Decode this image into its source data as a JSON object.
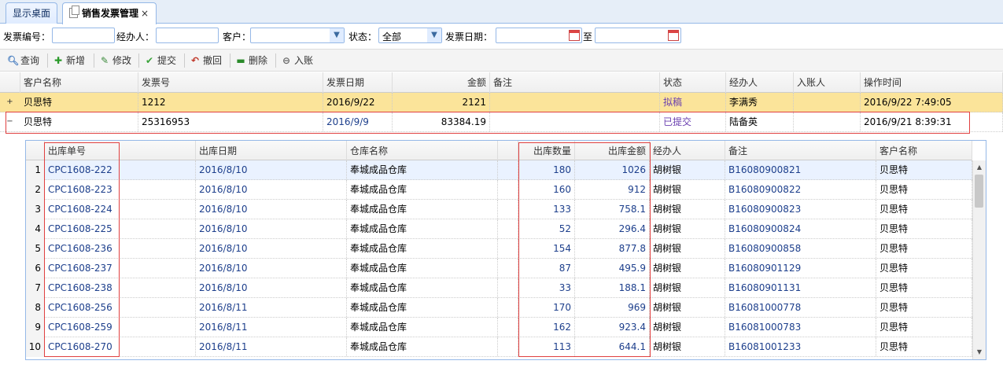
{
  "tabs": [
    {
      "label": "显示桌面"
    },
    {
      "label": "销售发票管理",
      "close": "×"
    }
  ],
  "search": {
    "invoice_no_label": "发票编号：",
    "handler_label": "经办人：",
    "customer_label": "客户：",
    "status_label": "状态：",
    "status_value": "全部",
    "date_label": "发票日期：",
    "date_to": "至"
  },
  "toolbar": {
    "query": "查询",
    "add": "新增",
    "edit": "修改",
    "submit": "提交",
    "revoke": "撤回",
    "delete": "删除",
    "post": "入账"
  },
  "grid": {
    "columns": [
      "客户名称",
      "发票号",
      "发票日期",
      "金额",
      "备注",
      "状态",
      "经办人",
      "入账人",
      "操作时间"
    ],
    "rows": [
      {
        "expander": "+",
        "customer": "贝思特",
        "invoice_no": "1212",
        "date": "2016/9/22",
        "amount": "2121",
        "remark": "",
        "status": "拟稿",
        "handler": "李满秀",
        "poster": "",
        "op_time": "2016/9/22 7:49:05"
      },
      {
        "expander": "−",
        "customer": "贝思特",
        "invoice_no": "25316953",
        "date": "2016/9/9",
        "amount": "83384.19",
        "remark": "",
        "status": "已提交",
        "handler": "陆备英",
        "poster": "",
        "op_time": "2016/9/21 8:39:31"
      }
    ]
  },
  "detail": {
    "columns": [
      "出库单号",
      "出库日期",
      "仓库名称",
      "出库数量",
      "出库金额",
      "经办人",
      "备注",
      "客户名称"
    ],
    "rows": [
      {
        "n": "1",
        "no": "CPC1608-222",
        "date": "2016/8/10",
        "wh": "奉城成品仓库",
        "qty": "180",
        "amt": "1026",
        "handler": "胡树银",
        "remark": "B16080900821",
        "cust": "贝思特"
      },
      {
        "n": "2",
        "no": "CPC1608-223",
        "date": "2016/8/10",
        "wh": "奉城成品仓库",
        "qty": "160",
        "amt": "912",
        "handler": "胡树银",
        "remark": "B16080900822",
        "cust": "贝思特"
      },
      {
        "n": "3",
        "no": "CPC1608-224",
        "date": "2016/8/10",
        "wh": "奉城成品仓库",
        "qty": "133",
        "amt": "758.1",
        "handler": "胡树银",
        "remark": "B16080900823",
        "cust": "贝思特"
      },
      {
        "n": "4",
        "no": "CPC1608-225",
        "date": "2016/8/10",
        "wh": "奉城成品仓库",
        "qty": "52",
        "amt": "296.4",
        "handler": "胡树银",
        "remark": "B16080900824",
        "cust": "贝思特"
      },
      {
        "n": "5",
        "no": "CPC1608-236",
        "date": "2016/8/10",
        "wh": "奉城成品仓库",
        "qty": "154",
        "amt": "877.8",
        "handler": "胡树银",
        "remark": "B16080900858",
        "cust": "贝思特"
      },
      {
        "n": "6",
        "no": "CPC1608-237",
        "date": "2016/8/10",
        "wh": "奉城成品仓库",
        "qty": "87",
        "amt": "495.9",
        "handler": "胡树银",
        "remark": "B16080901129",
        "cust": "贝思特"
      },
      {
        "n": "7",
        "no": "CPC1608-238",
        "date": "2016/8/10",
        "wh": "奉城成品仓库",
        "qty": "33",
        "amt": "188.1",
        "handler": "胡树银",
        "remark": "B16080901131",
        "cust": "贝思特"
      },
      {
        "n": "8",
        "no": "CPC1608-256",
        "date": "2016/8/11",
        "wh": "奉城成品仓库",
        "qty": "170",
        "amt": "969",
        "handler": "胡树银",
        "remark": "B16081000778",
        "cust": "贝思特"
      },
      {
        "n": "9",
        "no": "CPC1608-259",
        "date": "2016/8/11",
        "wh": "奉城成品仓库",
        "qty": "162",
        "amt": "923.4",
        "handler": "胡树银",
        "remark": "B16081000783",
        "cust": "贝思特"
      },
      {
        "n": "10",
        "no": "CPC1608-270",
        "date": "2016/8/11",
        "wh": "奉城成品仓库",
        "qty": "113",
        "amt": "644.1",
        "handler": "胡树银",
        "remark": "B16081001233",
        "cust": "贝思特"
      }
    ]
  },
  "colors": {
    "selected_row": "#fbe49a",
    "link_blue": "#1d3f8c",
    "highlight_box": "#e04040"
  }
}
